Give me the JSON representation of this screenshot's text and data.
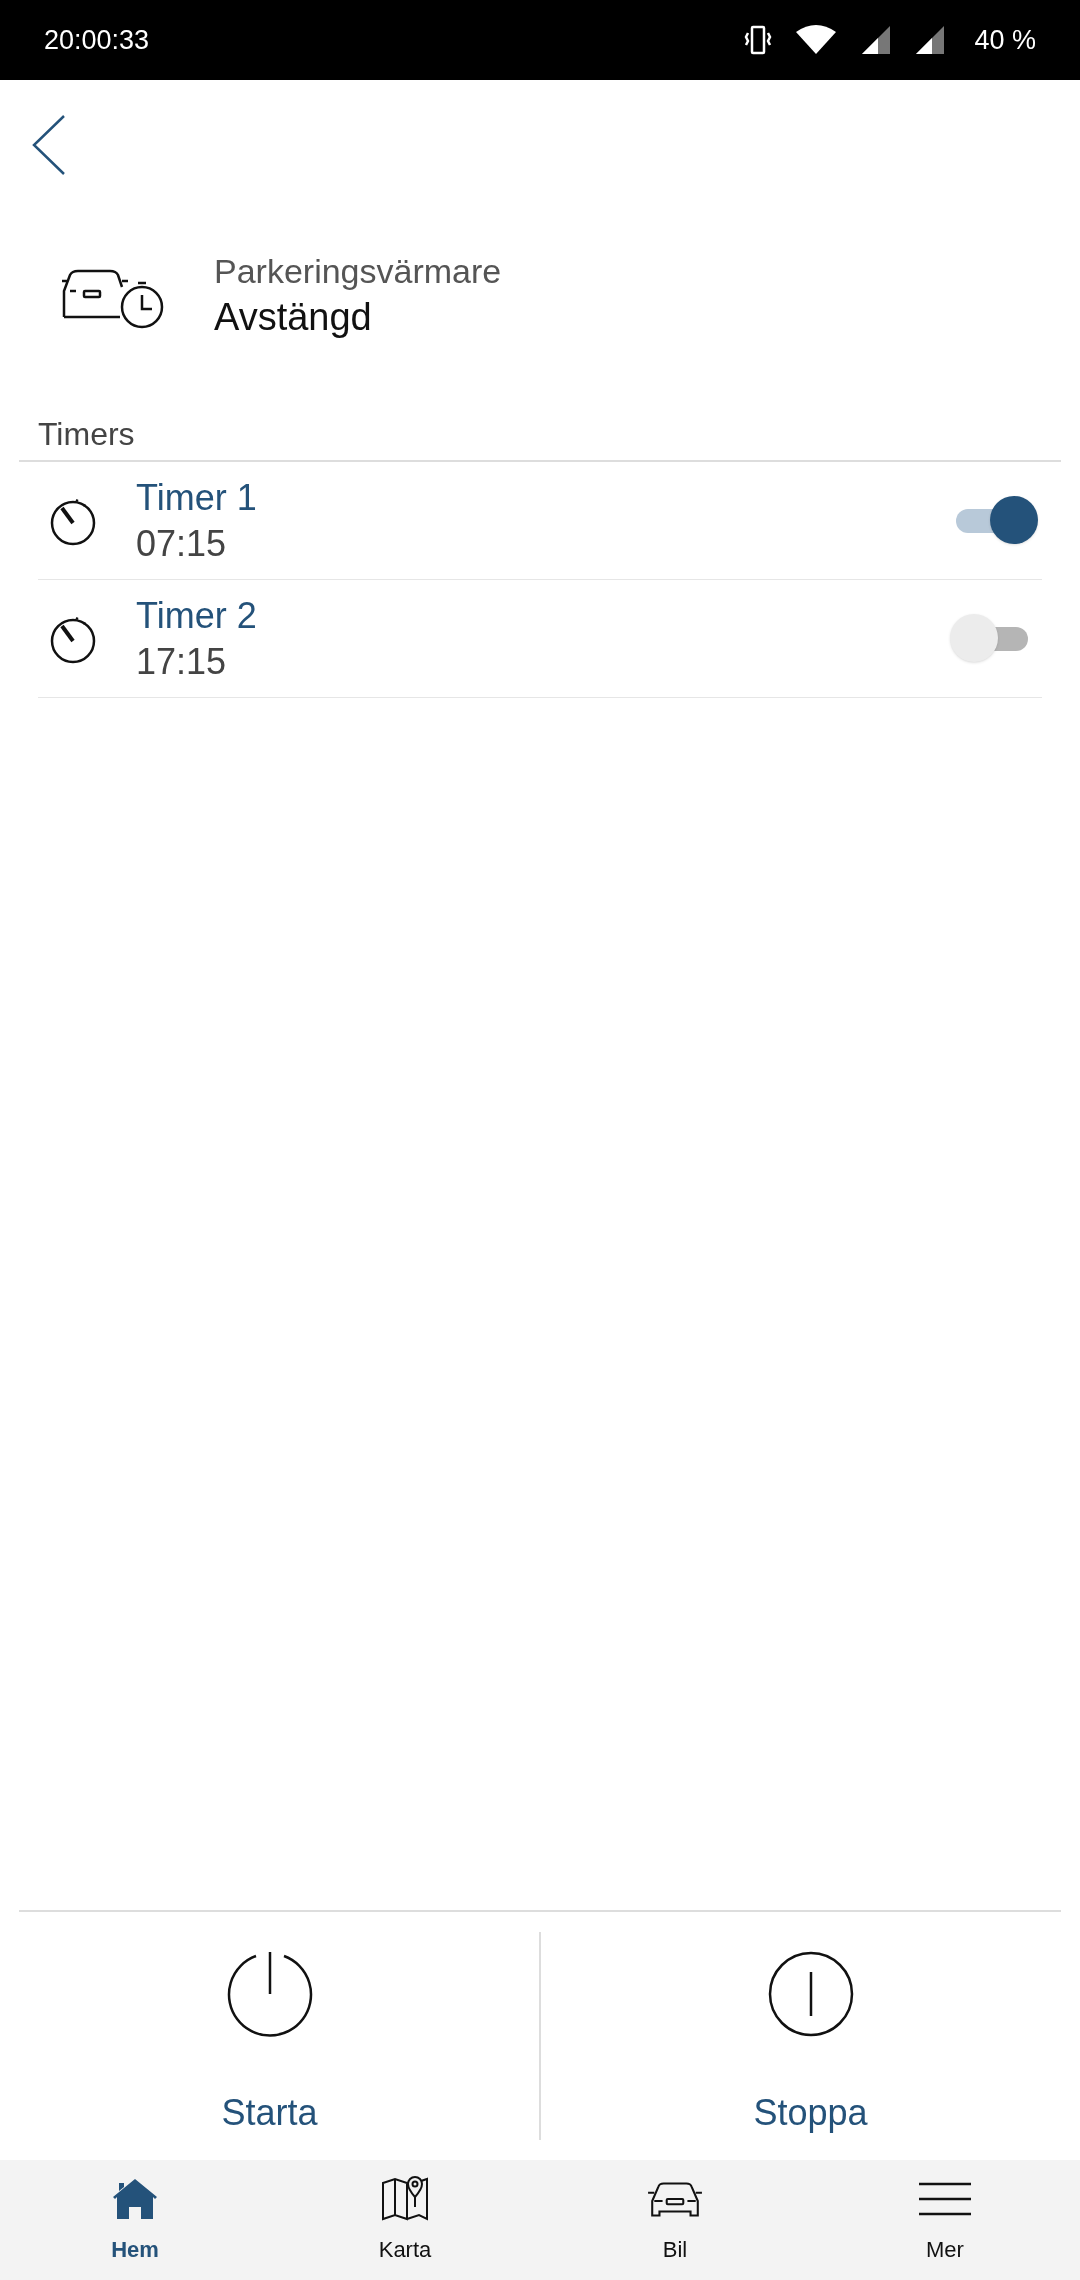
{
  "status_bar": {
    "time": "20:00:33",
    "battery": "40 %"
  },
  "header": {
    "title": "Parkeringsvärmare",
    "status": "Avstängd"
  },
  "timers": {
    "heading": "Timers",
    "items": [
      {
        "name": "Timer 1",
        "time": "07:15",
        "on": true
      },
      {
        "name": "Timer 2",
        "time": "17:15",
        "on": false
      }
    ]
  },
  "actions": [
    {
      "kind": "start",
      "label": "Starta"
    },
    {
      "kind": "stop",
      "label": "Stoppa"
    }
  ],
  "nav": [
    {
      "kind": "home",
      "label": "Hem",
      "selected": true
    },
    {
      "kind": "map",
      "label": "Karta",
      "selected": false
    },
    {
      "kind": "car",
      "label": "Bil",
      "selected": false
    },
    {
      "kind": "menu",
      "label": "Mer",
      "selected": false
    }
  ]
}
